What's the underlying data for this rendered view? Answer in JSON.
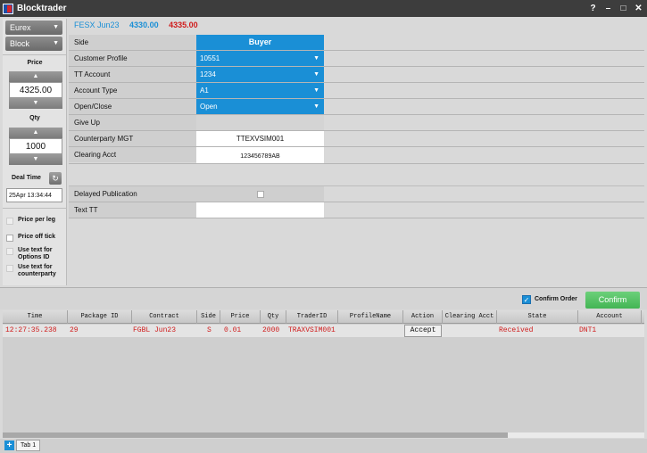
{
  "window": {
    "title": "Blocktrader"
  },
  "left": {
    "exchange": "Eurex",
    "trade_type": "Block",
    "price_label": "Price",
    "price_value": "4325.00",
    "qty_label": "Qty",
    "qty_value": "1000",
    "deal_time_label": "Deal Time",
    "deal_time_value": "25Apr 13:34:44",
    "checks": [
      {
        "label": "Price per leg"
      },
      {
        "label": "Price off tick"
      },
      {
        "label": "Use text for Options ID"
      },
      {
        "label": "Use text for counterparty"
      }
    ]
  },
  "header": {
    "instrument": "FESX Jun23",
    "bid": "4330.00",
    "ask": "4335.00",
    "instrument_color": "#1a8fd6",
    "bid_color": "#1a8fd6",
    "ask_color": "#d01c1c"
  },
  "form": {
    "side": {
      "label": "Side",
      "value": "Buyer"
    },
    "customer_profile": {
      "label": "Customer Profile",
      "value": "10551"
    },
    "tt_account": {
      "label": "TT Account",
      "value": "1234"
    },
    "account_type": {
      "label": "Account Type",
      "value": "A1"
    },
    "open_close": {
      "label": "Open/Close",
      "value": "Open"
    },
    "give_up": {
      "label": "Give Up",
      "value": ""
    },
    "counterparty": {
      "label": "Counterparty MGT",
      "value": "TTEXVSIM001"
    },
    "clearing_acct": {
      "label": "Clearing Acct",
      "value": "123456789AB"
    },
    "delayed_publication": {
      "label": "Delayed Publication"
    },
    "text_tt": {
      "label": "Text TT",
      "value": ""
    }
  },
  "confirm": {
    "checkbox_label": "Confirm Order",
    "button_label": "Confirm"
  },
  "grid": {
    "columns": [
      "Time",
      "Package ID",
      "Contract",
      "Side",
      "Price",
      "Qty",
      "TraderID",
      "ProfileName",
      "Action",
      "Clearing Acct",
      "State",
      "Account"
    ],
    "rows": [
      {
        "time": "12:27:35.238",
        "package_id": "29",
        "contract": "FGBL Jun23",
        "side": "S",
        "price": "0.01",
        "qty": "2000",
        "trader_id": "TRAXVSIM001",
        "profile_name": "",
        "action": "Accept",
        "clearing_acct": "",
        "state": "Received",
        "account": "DNT1"
      }
    ]
  },
  "tabs": [
    {
      "label": "Tab 1"
    }
  ]
}
